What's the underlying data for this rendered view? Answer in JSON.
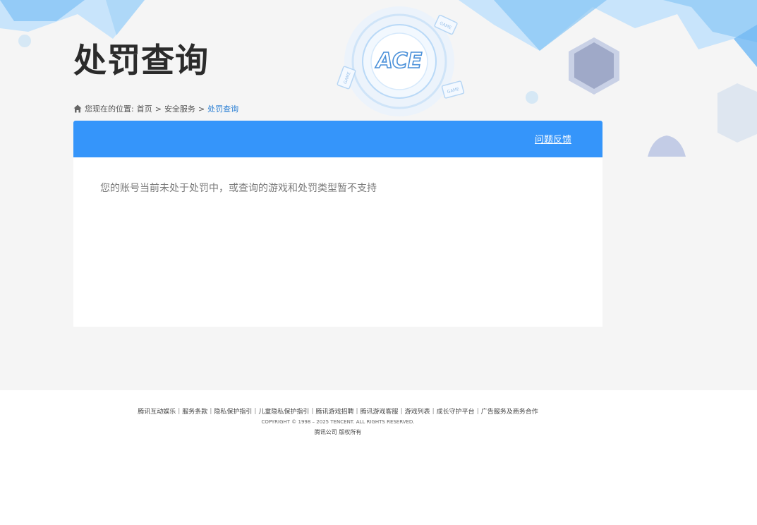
{
  "header": {
    "title": "处罚查询",
    "logo_text": "ACE",
    "card_labels": [
      "GAME",
      "GAME",
      "GAME"
    ]
  },
  "breadcrumb": {
    "prefix": "您现在的位置:",
    "items": [
      "首页",
      "安全服务",
      "处罚查询"
    ],
    "separator": ">"
  },
  "panel": {
    "feedback_label": "问题反馈",
    "message": "您的账号当前未处于处罚中，或查询的游戏和处罚类型暂不支持"
  },
  "footer": {
    "links": [
      "腾讯互动娱乐",
      "服务条款",
      "隐私保护指引",
      "儿童隐私保护指引",
      "腾讯游戏招聘",
      "腾讯游戏客服",
      "游戏列表",
      "成长守护平台",
      "广告服务及商务合作"
    ],
    "link_separator": "|",
    "copyright": "COPYRIGHT © 1998 – 2025 TENCENT. ALL RIGHTS RESERVED.",
    "rights": "腾讯公司 版权所有"
  },
  "colors": {
    "accent": "#3595fa",
    "background": "#f5f5f5",
    "breadcrumb_current": "#2a7fd4"
  },
  "icons": {
    "breadcrumb": "home-icon"
  }
}
